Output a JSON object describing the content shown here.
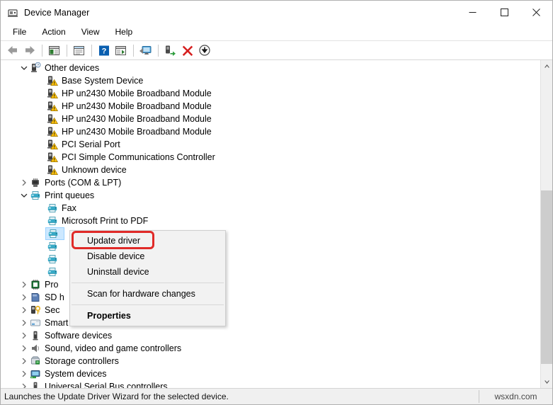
{
  "window": {
    "title": "Device Manager",
    "icon": "device-manager-icon",
    "controls": {
      "minimize": "minimize-icon",
      "maximize": "maximize-icon",
      "close": "close-icon"
    }
  },
  "menubar": {
    "items": [
      {
        "label": "File",
        "name": "menu-file"
      },
      {
        "label": "Action",
        "name": "menu-action"
      },
      {
        "label": "View",
        "name": "menu-view"
      },
      {
        "label": "Help",
        "name": "menu-help"
      }
    ]
  },
  "toolbar": {
    "buttons": [
      {
        "name": "back-button",
        "icon": "back-arrow-icon"
      },
      {
        "name": "forward-button",
        "icon": "forward-arrow-icon"
      },
      {
        "name": "separator-1",
        "icon": "separator"
      },
      {
        "name": "show-hide-console-tree-button",
        "icon": "console-tree-icon"
      },
      {
        "name": "separator-2",
        "icon": "separator"
      },
      {
        "name": "properties-button",
        "icon": "properties-window-icon"
      },
      {
        "name": "separator-3",
        "icon": "separator"
      },
      {
        "name": "help-button",
        "icon": "help-question-icon"
      },
      {
        "name": "show-hide-action-pane-button",
        "icon": "action-pane-icon"
      },
      {
        "name": "separator-4",
        "icon": "separator"
      },
      {
        "name": "scan-for-hardware-changes-button",
        "icon": "scan-monitor-icon"
      },
      {
        "name": "separator-5",
        "icon": "separator"
      },
      {
        "name": "update-driver-button",
        "icon": "update-driver-icon"
      },
      {
        "name": "uninstall-device-button",
        "icon": "red-x-icon"
      },
      {
        "name": "disable-device-button",
        "icon": "down-arrow-circle-icon"
      }
    ]
  },
  "tree": {
    "rows": [
      {
        "label": "Other devices",
        "depth": 0,
        "twisty": "expanded",
        "icon": "unknown-device-icon",
        "name": "tree-node-other-devices",
        "selected": false
      },
      {
        "label": "Base System Device",
        "depth": 1,
        "twisty": "none",
        "icon": "warning-device-icon",
        "name": "tree-item-base-system-device",
        "selected": false
      },
      {
        "label": "HP un2430 Mobile Broadband Module",
        "depth": 1,
        "twisty": "none",
        "icon": "warning-device-icon",
        "name": "tree-item-hp-un2430-1",
        "selected": false
      },
      {
        "label": "HP un2430 Mobile Broadband Module",
        "depth": 1,
        "twisty": "none",
        "icon": "warning-device-icon",
        "name": "tree-item-hp-un2430-2",
        "selected": false
      },
      {
        "label": "HP un2430 Mobile Broadband Module",
        "depth": 1,
        "twisty": "none",
        "icon": "warning-device-icon",
        "name": "tree-item-hp-un2430-3",
        "selected": false
      },
      {
        "label": "HP un2430 Mobile Broadband Module",
        "depth": 1,
        "twisty": "none",
        "icon": "warning-device-icon",
        "name": "tree-item-hp-un2430-4",
        "selected": false
      },
      {
        "label": "PCI Serial Port",
        "depth": 1,
        "twisty": "none",
        "icon": "warning-device-icon",
        "name": "tree-item-pci-serial-port",
        "selected": false
      },
      {
        "label": "PCI Simple Communications Controller",
        "depth": 1,
        "twisty": "none",
        "icon": "warning-device-icon",
        "name": "tree-item-pci-simple-comms-controller",
        "selected": false
      },
      {
        "label": "Unknown device",
        "depth": 1,
        "twisty": "none",
        "icon": "warning-device-icon",
        "name": "tree-item-unknown-device",
        "selected": false
      },
      {
        "label": "Ports (COM & LPT)",
        "depth": 0,
        "twisty": "collapsed",
        "icon": "ports-icon",
        "name": "tree-node-ports",
        "selected": false
      },
      {
        "label": "Print queues",
        "depth": 0,
        "twisty": "expanded",
        "icon": "printer-icon",
        "name": "tree-node-print-queues",
        "selected": false
      },
      {
        "label": "Fax",
        "depth": 1,
        "twisty": "none",
        "icon": "printer-icon",
        "name": "tree-item-fax",
        "selected": false
      },
      {
        "label": "Microsoft Print to PDF",
        "depth": 1,
        "twisty": "none",
        "icon": "printer-icon",
        "name": "tree-item-microsoft-print-to-pdf",
        "selected": false
      },
      {
        "label": "",
        "depth": 1,
        "twisty": "none",
        "icon": "printer-icon",
        "name": "tree-item-printer-selected",
        "selected": true
      },
      {
        "label": "",
        "depth": 1,
        "twisty": "none",
        "icon": "printer-icon",
        "name": "tree-item-printer-2",
        "selected": false
      },
      {
        "label": "",
        "depth": 1,
        "twisty": "none",
        "icon": "printer-icon",
        "name": "tree-item-printer-3",
        "selected": false
      },
      {
        "label": "",
        "depth": 1,
        "twisty": "none",
        "icon": "printer-icon",
        "name": "tree-item-printer-4",
        "selected": false
      },
      {
        "label": "Pro",
        "depth": 0,
        "twisty": "collapsed",
        "icon": "processor-icon",
        "name": "tree-node-processors",
        "selected": false
      },
      {
        "label": "SD h",
        "depth": 0,
        "twisty": "collapsed",
        "icon": "sd-host-icon",
        "name": "tree-node-sd-host-adapters",
        "selected": false
      },
      {
        "label": "Sec",
        "depth": 0,
        "twisty": "collapsed",
        "icon": "security-devices-icon",
        "name": "tree-node-security-devices",
        "selected": false
      },
      {
        "label": "Smart card readers",
        "depth": 0,
        "twisty": "collapsed",
        "icon": "smart-card-reader-icon",
        "name": "tree-node-smart-card-readers",
        "selected": false
      },
      {
        "label": "Software devices",
        "depth": 0,
        "twisty": "collapsed",
        "icon": "software-device-icon",
        "name": "tree-node-software-devices",
        "selected": false
      },
      {
        "label": "Sound, video and game controllers",
        "depth": 0,
        "twisty": "collapsed",
        "icon": "speaker-icon",
        "name": "tree-node-sound-video-game-controllers",
        "selected": false
      },
      {
        "label": "Storage controllers",
        "depth": 0,
        "twisty": "collapsed",
        "icon": "storage-controller-icon",
        "name": "tree-node-storage-controllers",
        "selected": false
      },
      {
        "label": "System devices",
        "depth": 0,
        "twisty": "collapsed",
        "icon": "system-device-icon",
        "name": "tree-node-system-devices",
        "selected": false
      },
      {
        "label": "Universal Serial Bus controllers",
        "depth": 0,
        "twisty": "collapsed",
        "icon": "usb-icon",
        "name": "tree-node-usb-controllers",
        "selected": false
      }
    ]
  },
  "context_menu": {
    "items": [
      {
        "label": "Update driver",
        "type": "item",
        "bold": false,
        "highlighted": true,
        "name": "context-menu-update-driver"
      },
      {
        "label": "Disable device",
        "type": "item",
        "bold": false,
        "highlighted": false,
        "name": "context-menu-disable-device"
      },
      {
        "label": "Uninstall device",
        "type": "item",
        "bold": false,
        "highlighted": false,
        "name": "context-menu-uninstall-device"
      },
      {
        "label": "",
        "type": "separator",
        "name": "context-menu-separator-1"
      },
      {
        "label": "Scan for hardware changes",
        "type": "item",
        "bold": false,
        "highlighted": false,
        "name": "context-menu-scan-for-hardware-changes"
      },
      {
        "label": "",
        "type": "separator",
        "name": "context-menu-separator-2"
      },
      {
        "label": "Properties",
        "type": "item",
        "bold": true,
        "highlighted": false,
        "name": "context-menu-properties"
      }
    ]
  },
  "statusbar": {
    "text": "Launches the Update Driver Wizard for the selected device.",
    "watermark": "wsxdn.com"
  },
  "colors": {
    "highlight_box": "#e02a28",
    "selection": "#cce8ff",
    "menu_bg": "#f2f2f2",
    "status_bg": "#f0f0f0",
    "printer_icon": "#2fa6c4",
    "warning": "#ffc20e"
  },
  "scrollbar": {
    "up_arrow": "scroll-up-icon",
    "down_arrow": "scroll-down-icon",
    "thumb_top_pct": 39,
    "thumb_height_pct": 57
  }
}
